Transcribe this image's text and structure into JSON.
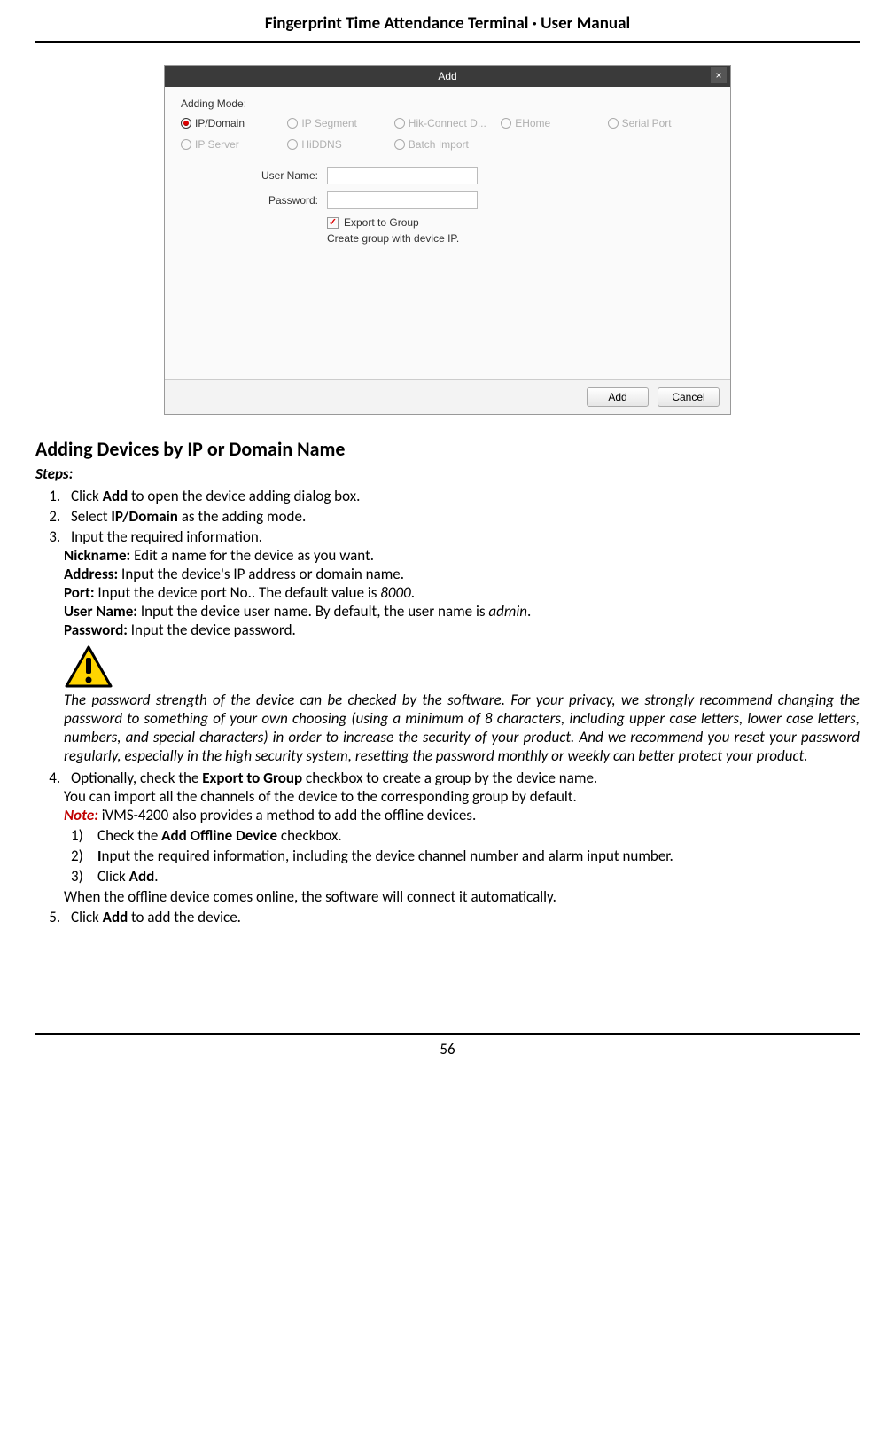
{
  "header": "Fingerprint Time Attendance Terminal · User Manual",
  "pageNumber": "56",
  "dialog": {
    "title": "Add",
    "closeGlyph": "×",
    "modeLabel": "Adding Mode:",
    "radios": [
      {
        "label": "IP/Domain",
        "selected": true
      },
      {
        "label": "IP Segment",
        "selected": false
      },
      {
        "label": "Hik-Connect D...",
        "selected": false
      },
      {
        "label": "EHome",
        "selected": false
      },
      {
        "label": "Serial Port",
        "selected": false
      },
      {
        "label": "IP Server",
        "selected": false
      },
      {
        "label": "HiDDNS",
        "selected": false
      },
      {
        "label": "Batch Import",
        "selected": false
      }
    ],
    "userNameLabel": "User Name:",
    "userNameValue": "",
    "passwordLabel": "Password:",
    "passwordValue": "",
    "exportCheck": "✓",
    "exportLabel": "Export to Group",
    "helperText": "Create group with device IP.",
    "addBtn": "Add",
    "cancelBtn": "Cancel"
  },
  "sectionTitle": "Adding Devices by IP or Domain Name",
  "stepsLabel": "Steps:",
  "step1_a": "Click ",
  "step1_b": "Add",
  "step1_c": " to open the device adding dialog box.",
  "step2_a": "Select ",
  "step2_b": "IP/Domain",
  "step2_c": " as the adding mode.",
  "step3": "Input the required information.",
  "nick_b": "Nickname:",
  "nick_t": " Edit a name for the device as you want.",
  "addr_b": "Address:",
  "addr_t": " Input the device's IP address or domain name.",
  "port_b": "Port:",
  "port_t1": " Input the device port No.. The default value is ",
  "port_i": "8000",
  "port_t2": ".",
  "user_b": "User Name:",
  "user_t1": " Input the device user name. By default, the user name is ",
  "user_i": "admin",
  "user_t2": ".",
  "pass_b": "Password:",
  "pass_t": " Input the device password.",
  "warningText": "The password strength of the device can be checked by the software. For your privacy, we strongly recommend changing the password to something of your own choosing (using a minimum of 8 characters, including upper case letters, lower case letters, numbers, and special characters) in order to increase the security of your product. And we recommend you reset your password regularly, especially in the high security system, resetting the password monthly or weekly can better protect your product.",
  "step4_a": "Optionally, check the ",
  "step4_b": "Export to Group",
  "step4_c": " checkbox to create a group by the device name.",
  "step4_line2": "You can import all the channels of the device to the corresponding group by default.",
  "noteLabel": "Note:",
  "noteText": " iVMS-4200 also provides a method to add the offline devices.",
  "sub1_n": "1)",
  "sub1_a": "Check the ",
  "sub1_b": "Add Offline Device",
  "sub1_c": " checkbox.",
  "sub2_n": "2)",
  "sub2_a": "I",
  "sub2_b": "nput the required information, including the device channel number and alarm input number.",
  "sub3_n": "3)",
  "sub3_a": "Click ",
  "sub3_b": "Add",
  "sub3_c": ".",
  "step4_last": "When the offline device comes online, the software will connect it automatically.",
  "step5_a": "Click ",
  "step5_b": "Add",
  "step5_c": " to add the device."
}
